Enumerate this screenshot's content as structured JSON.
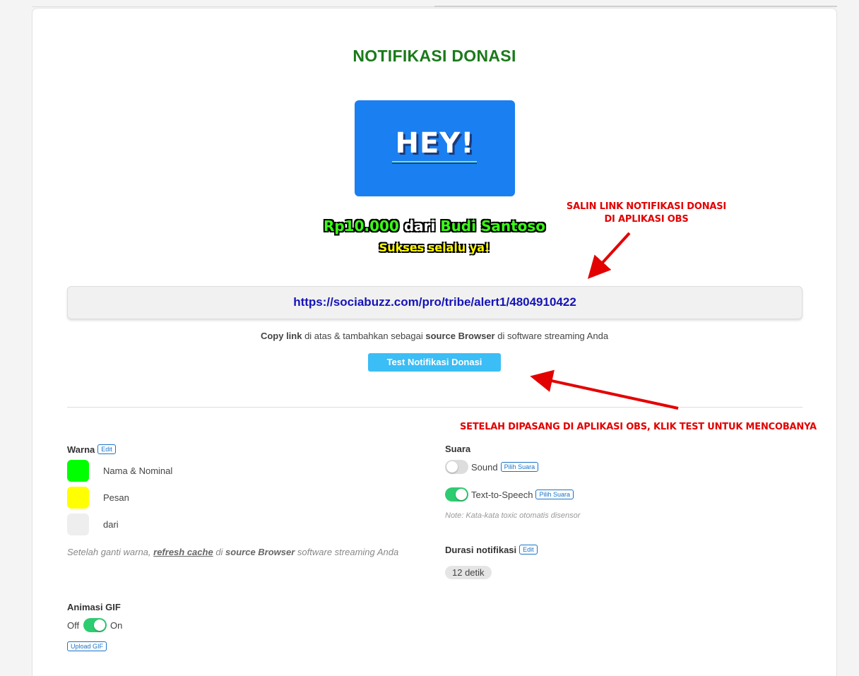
{
  "page": {
    "title": "NOTIFIKASI DONASI"
  },
  "preview": {
    "gif_text": "HEY!",
    "amount": "Rp10.000",
    "from_word": "dari",
    "donor": "Budi Santoso",
    "message": "Sukses selalu ya!"
  },
  "link": {
    "url": "https://sociabuzz.com/pro/tribe/alert1/4804910422",
    "hint_bold1": "Copy link",
    "hint_mid": " di atas & tambahkan sebagai ",
    "hint_bold2": "source Browser",
    "hint_end": " di software streaming Anda"
  },
  "test_button": "Test Notifikasi Donasi",
  "annotations": {
    "copy_line1": "SALIN LINK NOTIFIKASI DONASI",
    "copy_line2": "DI APLIKASI OBS",
    "test_note": "SETELAH DIPASANG DI APLIKASI OBS, KLIK TEST UNTUK MENCOBANYA",
    "color": "#e30000"
  },
  "warna": {
    "label": "Warna",
    "edit": "Edit",
    "items": [
      {
        "label": "Nama & Nominal",
        "color": "#00ff00"
      },
      {
        "label": "Pesan",
        "color": "#ffff00"
      },
      {
        "label": "dari",
        "color": "#eeeeee"
      }
    ],
    "note_pre": "Setelah ganti warna, ",
    "note_link": "refresh cache",
    "note_mid": " di ",
    "note_bold": "source Browser",
    "note_end": " software streaming Anda"
  },
  "animasi": {
    "label": "Animasi GIF",
    "off": "Off",
    "on": "On",
    "enabled": true,
    "upload": "Upload GIF"
  },
  "suara": {
    "label": "Suara",
    "sound_label": "Sound",
    "sound_enabled": false,
    "pick": "Pilih Suara",
    "tts_label": "Text-to-Speech",
    "tts_enabled": true,
    "note": "Note: Kata-kata toxic otomatis disensor"
  },
  "durasi": {
    "label": "Durasi notifikasi",
    "edit": "Edit",
    "value": "12 detik"
  }
}
